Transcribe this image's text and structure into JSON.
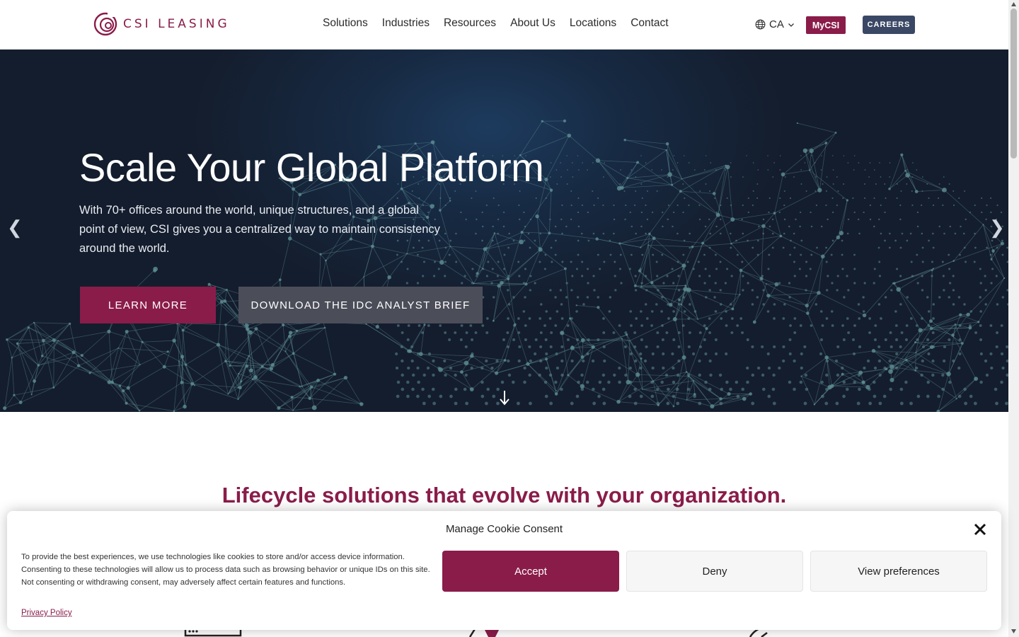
{
  "header": {
    "logo_text": "CSI LEASING",
    "nav": [
      "Solutions",
      "Industries",
      "Resources",
      "About Us",
      "Locations",
      "Contact"
    ],
    "region": "CA",
    "mycsi_label": "MyCSI",
    "careers_label": "CAREERS"
  },
  "hero": {
    "title": "Scale Your Global Platform",
    "body": "With 70+ offices around the world, unique structures, and a global point of view, CSI gives you a centralized way to maintain consistency around the world.",
    "learn_more_label": "LEARN MORE",
    "download_label": "DOWNLOAD THE IDC ANALYST BRIEF",
    "prev_arrow": "❮",
    "next_arrow": "❯"
  },
  "section": {
    "title": "Lifecycle solutions that evolve with your organization."
  },
  "cookie": {
    "title": "Manage Cookie Consent",
    "text": "To provide the best experiences, we use technologies like cookies to store and/or access device information. Consenting to these technologies will allow us to process data such as browsing behavior or unique IDs on this site. Not consenting or withdrawing consent, may adversely affect certain features and functions.",
    "privacy_label": "Privacy Policy",
    "accept_label": "Accept",
    "deny_label": "Deny",
    "preferences_label": "View preferences"
  },
  "colors": {
    "brand": "#8a1c4a",
    "careers_bg": "#3a4866",
    "hero_bg": "#141d2d",
    "globe_dots": "#5e8e95"
  }
}
